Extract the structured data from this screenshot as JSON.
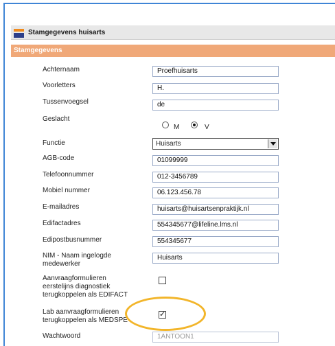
{
  "header": {
    "title": "Stamgegevens huisarts"
  },
  "section": {
    "title": "Stamgegevens"
  },
  "fields": {
    "achternaam": {
      "label": "Achternaam",
      "value": "Proefhuisarts"
    },
    "voorletters": {
      "label": "Voorletters",
      "value": "H."
    },
    "tussenvoegsel": {
      "label": "Tussenvoegsel",
      "value": "de"
    },
    "geslacht": {
      "label": "Geslacht",
      "option_m": "M",
      "option_v": "V",
      "selected": "V"
    },
    "functie": {
      "label": "Functie",
      "value": "Huisarts"
    },
    "agb": {
      "label": "AGB-code",
      "value": "01099999"
    },
    "telefoon": {
      "label": "Telefoonnummer",
      "value": "012-3456789"
    },
    "mobiel": {
      "label": "Mobiel nummer",
      "value": "06.123.456.78"
    },
    "email": {
      "label": "E-mailadres",
      "value": "huisarts@huisartsenpraktijk.nl"
    },
    "edifact": {
      "label": "Edifactadres",
      "value": "554345677@lifeline.lms.nl"
    },
    "edipost": {
      "label": "Edipostbusnummer",
      "value": "554345677"
    },
    "nim": {
      "label": "NIM - Naam ingelogde medewerker",
      "value": "Huisarts"
    },
    "aanvraag_edifact": {
      "label": "Aanvraagformulieren eerstelijns diagnostiek terugkoppelen als EDIFACT",
      "checked": false
    },
    "lab_medspe": {
      "label": "Lab aanvraagformulieren terugkoppelen als MEDSPE",
      "checked": true
    },
    "wachtwoord": {
      "label": "Wachtwoord",
      "value": "1ANTOON1"
    }
  },
  "colors": {
    "accent_orange": "#f0a878",
    "frame_blue": "#3f85d6",
    "highlight_ellipse": "#f2b52a"
  }
}
